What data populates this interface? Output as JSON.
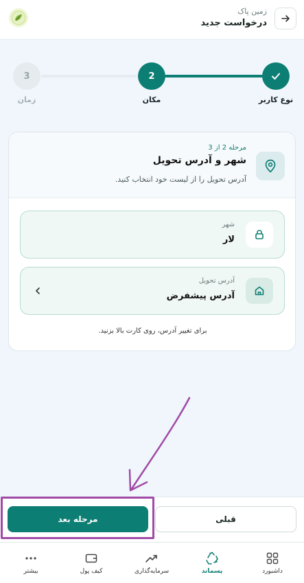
{
  "header": {
    "subtitle": "زمین پاک",
    "title": "درخواست جدید",
    "back_icon": "arrow-right-icon",
    "logo_icon": "leaf-logo"
  },
  "stepper": {
    "steps": [
      {
        "label": "نوع کاربر",
        "marker": "",
        "state": "done"
      },
      {
        "label": "مکان",
        "marker": "2",
        "state": "active"
      },
      {
        "label": "زمان",
        "marker": "3",
        "state": "pending"
      }
    ]
  },
  "card": {
    "step_count": "مرحله 2 از 3",
    "title": "شهر و آدرس تحویل",
    "description": "آدرس تحویل را از لیست خود انتخاب کنید.",
    "city": {
      "label": "شهر",
      "value": "لار",
      "icon": "lock-icon"
    },
    "address": {
      "label": "آدرس تحویل",
      "value": "آدرس پیشفرض",
      "icon": "home-icon"
    },
    "hint": "برای تغییر آدرس، روی کارت بالا بزنید."
  },
  "actions": {
    "next_label": "مرحله بعد",
    "prev_label": "قبلی"
  },
  "nav": {
    "items": [
      {
        "label": "داشبورد",
        "icon": "grid-icon"
      },
      {
        "label": "پسماند",
        "icon": "recycle-icon",
        "active": true
      },
      {
        "label": "سرمایه‌گذاری",
        "icon": "trending-up-icon"
      },
      {
        "label": "کیف پول",
        "icon": "wallet-icon"
      },
      {
        "label": "بیشتر",
        "icon": "more-icon"
      }
    ]
  },
  "colors": {
    "primary": "#0d7e73",
    "pending": "#e5ebee",
    "annotation": "#a04aa6"
  }
}
